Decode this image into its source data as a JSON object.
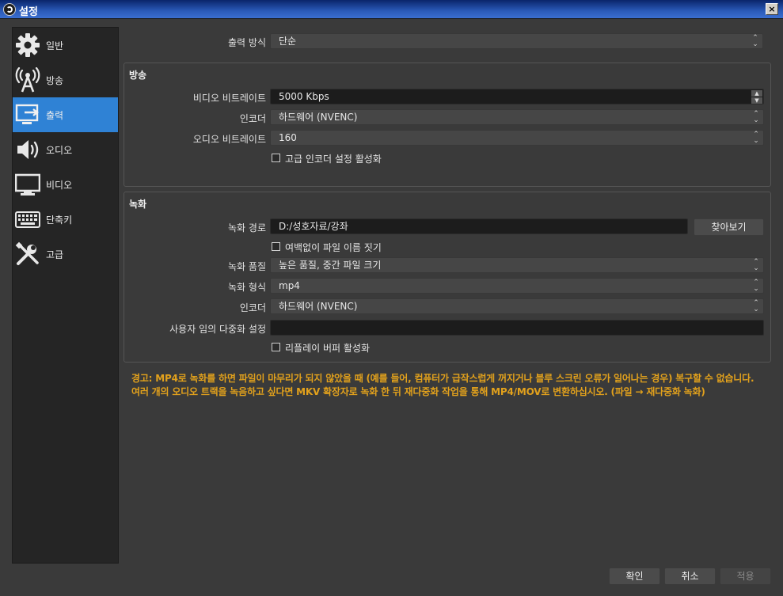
{
  "window": {
    "title": "설정",
    "close_label": "×"
  },
  "sidebar": {
    "items": [
      {
        "label": "일반",
        "icon": "gear-icon"
      },
      {
        "label": "방송",
        "icon": "broadcast-antenna-icon"
      },
      {
        "label": "출력",
        "icon": "output-monitor-icon",
        "active": true
      },
      {
        "label": "오디오",
        "icon": "speaker-icon"
      },
      {
        "label": "비디오",
        "icon": "monitor-icon"
      },
      {
        "label": "단축키",
        "icon": "keyboard-icon"
      },
      {
        "label": "고급",
        "icon": "tools-icon"
      }
    ]
  },
  "output_mode": {
    "label": "출력 방식",
    "value": "단순"
  },
  "streaming": {
    "title": "방송",
    "video_bitrate_label": "비디오 비트레이트",
    "video_bitrate_value": "5000 Kbps",
    "encoder_label": "인코더",
    "encoder_value": "하드웨어 (NVENC)",
    "audio_bitrate_label": "오디오 비트레이트",
    "audio_bitrate_value": "160",
    "advanced_encoder_checkbox": "고급 인코더 설정 활성화"
  },
  "recording": {
    "title": "녹화",
    "path_label": "녹화 경로",
    "path_value": "D:/성호자료/강좌",
    "browse_button": "찾아보기",
    "no_space_checkbox": "여백없이 파일 이름 짓기",
    "quality_label": "녹화 품질",
    "quality_value": "높은 품질, 중간 파일 크기",
    "format_label": "녹화 형식",
    "format_value": "mp4",
    "encoder_label": "인코더",
    "encoder_value": "하드웨어 (NVENC)",
    "muxer_label": "사용자 임의 다중화 설정",
    "muxer_value": "",
    "replay_buffer_checkbox": "리플레이 버퍼 활성화"
  },
  "warning_text": "경고: MP4로 녹화를 하면 파일이 마무리가 되지 않았을 때 (예를 들어, 컴퓨터가 급작스럽게 꺼지거나 블루 스크린 오류가 일어나는 경우) 복구할 수 없습니다. 여러 개의 오디오 트랙을 녹음하고 싶다면 MKV 확장자로 녹화 한 뒤 재다중화 작업을 통해 MP4/MOV로 변환하십시오. (파일 → 재다중화 녹화)",
  "footer": {
    "ok": "확인",
    "cancel": "취소",
    "apply": "적용"
  },
  "colors": {
    "accent": "#2f82d5",
    "warning": "#e2a11c",
    "background": "#3a3a3a"
  }
}
